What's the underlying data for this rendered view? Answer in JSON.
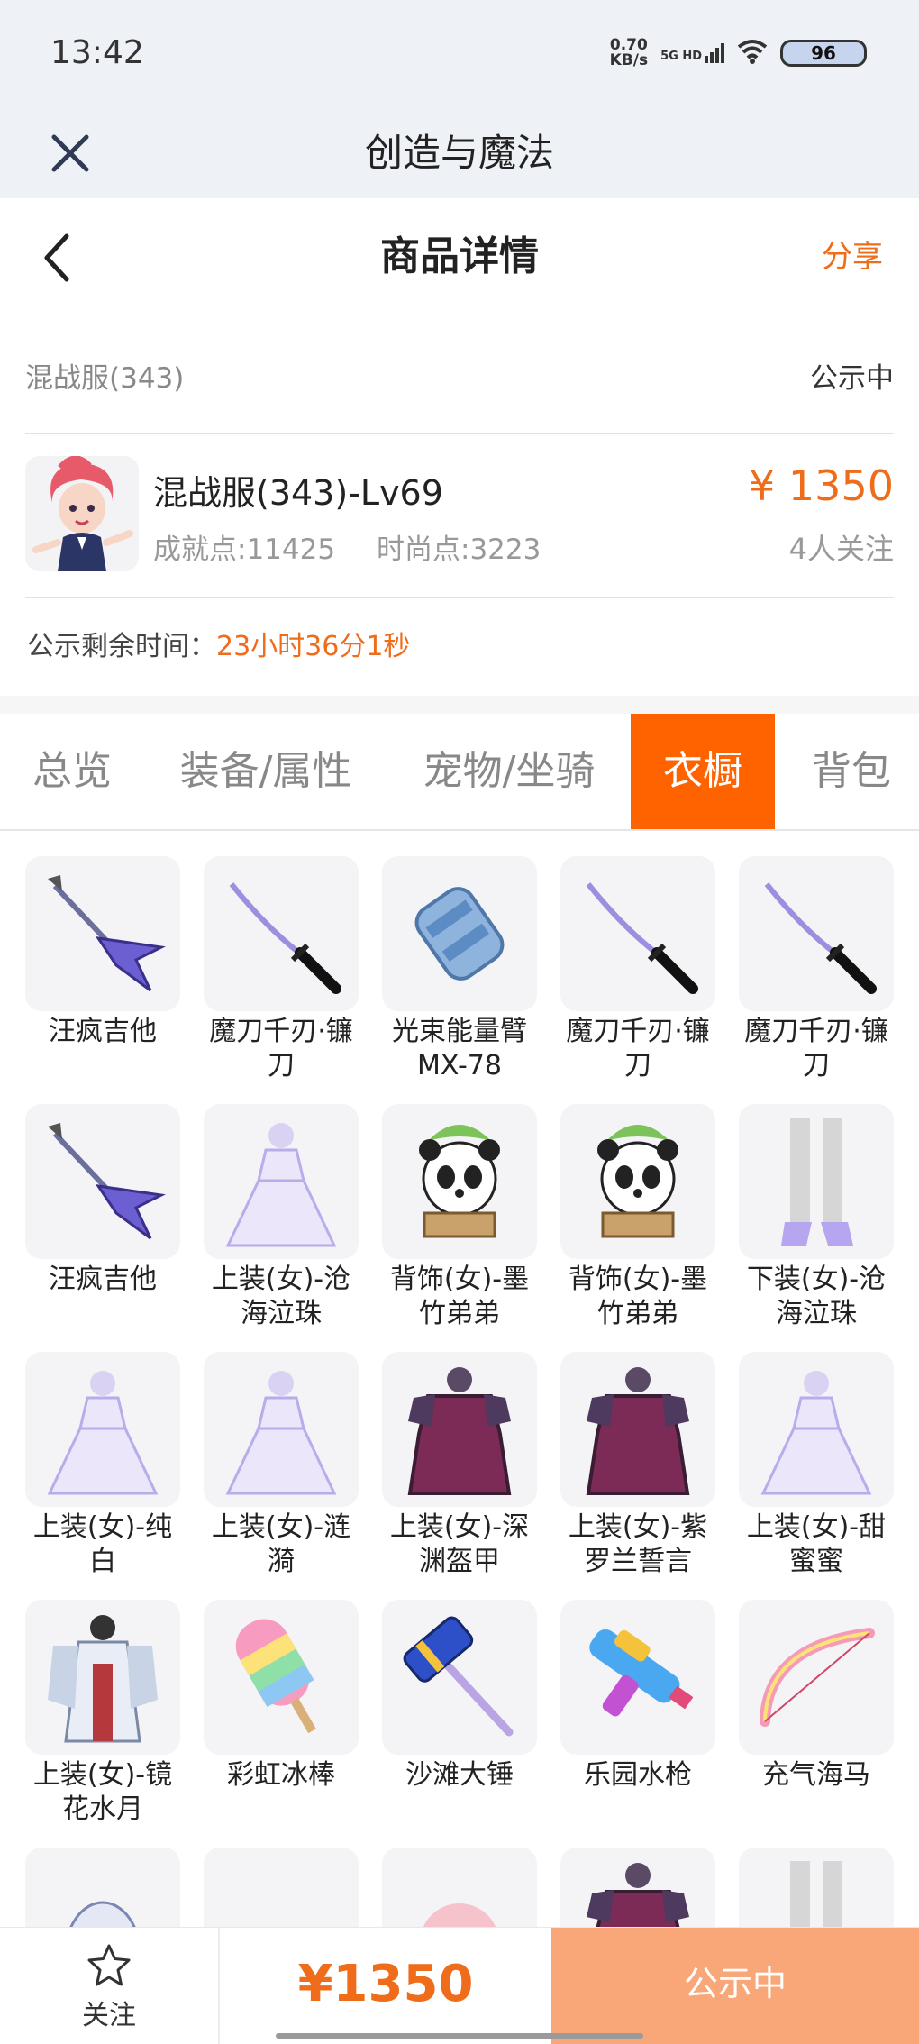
{
  "status_bar": {
    "time": "13:42",
    "net_speed_value": "0.70",
    "net_speed_unit": "KB/s",
    "signal": "5G HD",
    "battery": "96",
    "icons": [
      "signal-icon",
      "wifi-icon",
      "battery-icon"
    ]
  },
  "app": {
    "title": "创造与魔法",
    "close_icon": "close-icon"
  },
  "nav": {
    "title": "商品详情",
    "share": "分享",
    "back_icon": "back-chevron-icon"
  },
  "server": {
    "name": "混战服(343)",
    "status": "公示中"
  },
  "product": {
    "name": "混战服(343)-Lv69",
    "achievement": "成就点:11425",
    "fashion": "时尚点:3223",
    "price": "¥ 1350",
    "followers": "4人关注"
  },
  "countdown": {
    "label": "公示剩余时间：",
    "value": "23小时36分1秒"
  },
  "tabs": [
    {
      "label": "总览",
      "active": false
    },
    {
      "label": "装备/属性",
      "active": false
    },
    {
      "label": "宠物/坐骑",
      "active": false
    },
    {
      "label": "衣橱",
      "active": true
    },
    {
      "label": "背包",
      "active": false
    }
  ],
  "items": [
    {
      "label": "汪疯吉他",
      "icon": "guitar-icon"
    },
    {
      "label": "魔刀千刃·镰刀",
      "icon": "katana-icon"
    },
    {
      "label": "光束能量臂MX-78",
      "icon": "energy-arm-icon"
    },
    {
      "label": "魔刀千刃·镰刀",
      "icon": "katana-icon"
    },
    {
      "label": "魔刀千刃·镰刀",
      "icon": "katana-icon"
    },
    {
      "label": "汪疯吉他",
      "icon": "guitar-icon"
    },
    {
      "label": "上装(女)-沧海泣珠",
      "icon": "dress-icon"
    },
    {
      "label": "背饰(女)-墨竹弟弟",
      "icon": "panda-backpack-icon"
    },
    {
      "label": "背饰(女)-墨竹弟弟",
      "icon": "panda-backpack-icon"
    },
    {
      "label": "下装(女)-沧海泣珠",
      "icon": "legwear-icon"
    },
    {
      "label": "上装(女)-纯白",
      "icon": "dress-icon"
    },
    {
      "label": "上装(女)-涟漪",
      "icon": "dress-icon"
    },
    {
      "label": "上装(女)-深渊盔甲",
      "icon": "armor-icon"
    },
    {
      "label": "上装(女)-紫罗兰誓言",
      "icon": "armor-icon"
    },
    {
      "label": "上装(女)-甜蜜蜜",
      "icon": "dress-icon"
    },
    {
      "label": "上装(女)-镜花水月",
      "icon": "robe-icon"
    },
    {
      "label": "彩虹冰棒",
      "icon": "popsicle-icon"
    },
    {
      "label": "沙滩大锤",
      "icon": "hammer-icon"
    },
    {
      "label": "乐园水枪",
      "icon": "water-gun-icon"
    },
    {
      "label": "充气海马",
      "icon": "bow-icon"
    },
    {
      "label": "",
      "icon": "mask-icon"
    },
    {
      "label": "",
      "icon": "wing-icon"
    },
    {
      "label": "",
      "icon": "pig-icon"
    },
    {
      "label": "",
      "icon": "armor-icon"
    },
    {
      "label": "",
      "icon": "legwear-icon"
    }
  ],
  "bottom": {
    "follow": "关注",
    "price": "¥1350",
    "buy": "公示中",
    "star_icon": "star-icon"
  },
  "colors": {
    "accent": "#ef6c1a",
    "active_tab": "#ff6300",
    "buy_button": "#f9a778",
    "header_bg": "#eef1f6"
  }
}
